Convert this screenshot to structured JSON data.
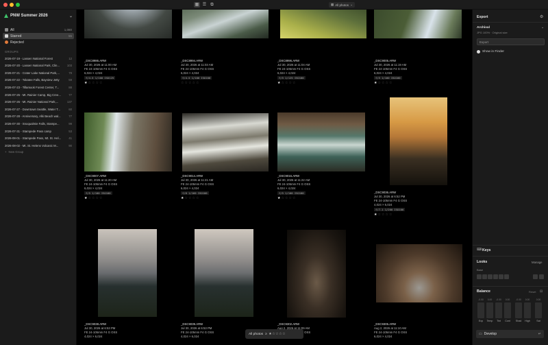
{
  "window": {
    "view_select": "All photos"
  },
  "sidebar": {
    "title": "PNW Summer 2026",
    "library": [
      {
        "label": "All",
        "count": "1,080",
        "color": "#8a8a8a"
      },
      {
        "label": "Starred",
        "count": "55",
        "color": "#d9d9d9"
      },
      {
        "label": "Rejected",
        "count": "",
        "color": "#e07a3a"
      }
    ],
    "groups_label": "GROUPS",
    "groups": [
      {
        "label": "2026-07-19 - Lassen National Forest",
        "count": "12"
      },
      {
        "label": "2026-07-20 - Lassen National Park, Clin...",
        "count": "103"
      },
      {
        "label": "2026-07-21 - Crater Lake National Park,...",
        "count": "79"
      },
      {
        "label": "2026-07-22 - Tokatee Falls, Bayview Jetty",
        "count": "59"
      },
      {
        "label": "2026-07-23 - Tillamook Forest Center, T...",
        "count": "88"
      },
      {
        "label": "2026-07-25 - Mt. Rainier Camp, Big Cree...",
        "count": "77"
      },
      {
        "label": "2026-07-26 - Mt. Rainier National Park,...",
        "count": "137"
      },
      {
        "label": "2026-07-27 - Downtown Seattle, Water T...",
        "count": "60"
      },
      {
        "label": "2026-07-28 - Anniversary, Alki Beach wal...",
        "count": "77"
      },
      {
        "label": "2026-07-30 - Snoqualmie Falls, Stampe...",
        "count": "99"
      },
      {
        "label": "2026-07-31 - Stampede Pass camp",
        "count": "53"
      },
      {
        "label": "2026-08-01 - Stampede Pass, Mt. St. Hel...",
        "count": "41"
      },
      {
        "label": "2026-08-02 - Mt. St. Helens Volcanic M...",
        "count": "90"
      }
    ],
    "new_group": "New Group"
  },
  "photos": [
    {
      "file": "_DSC8986.ARW",
      "date": "Jul 30, 2026 at 11:00 AM",
      "lens": "FE 24-105mm F4 G OSS",
      "dims": "6,024 × 4,024",
      "exif": "f/4.5 1/100 ISO125",
      "rating": 1
    },
    {
      "file": "_DSC8994.ARW",
      "date": "Jul 30, 2026 at 11:03 AM",
      "lens": "FE 24-105mm F4 G OSS",
      "dims": "6,024 × 4,024",
      "exif": "f/4.5 1/100 ISO100",
      "rating": 0
    },
    {
      "file": "_DSC8996.ARW",
      "date": "Jul 30, 2026 at 11:04 AM",
      "lens": "FE 24-105mm F4 G OSS",
      "dims": "6,024 × 4,024",
      "exif": "f/5 1/125 ISO100",
      "rating": 1
    },
    {
      "file": "_DSC9005.ARW",
      "date": "Jul 30, 2026 at 11:19 AM",
      "lens": "FE 24-105mm F4 G OSS",
      "dims": "6,024 × 4,024",
      "exif": "f/5 1/100 ISO100",
      "rating": 1
    },
    {
      "file": "_DSC9007.ARW",
      "date": "Jul 30, 2026 at 11:20 AM",
      "lens": "FE 24-105mm F4 G OSS",
      "dims": "6,024 × 4,024",
      "exif": "f/5 1/100 ISO100",
      "rating": 1
    },
    {
      "file": "_DSC9014.ARW",
      "date": "Jul 30, 2026 at 11:21 AM",
      "lens": "FE 24-105mm F4 G OSS",
      "dims": "6,024 × 4,024",
      "exif": "f/8 1/160 ISO100",
      "rating": 1
    },
    {
      "file": "_DSC9016.ARW",
      "date": "Jul 30, 2026 at 11:22 AM",
      "lens": "FE 24-105mm F4 G OSS",
      "dims": "6,024 × 4,024",
      "exif": "f/5 1/100 ISO100",
      "rating": 1
    },
    {
      "file": "_DSC9036.ARW",
      "date": "Jul 30, 2026 at 6:52 PM",
      "lens": "FE 24-105mm F4 G OSS",
      "dims": "4,024 × 6,024",
      "exif": "f/7.1 1/200 ISO100",
      "rating": 1
    },
    {
      "file": "_DSC9038.ARW",
      "date": "Jul 30, 2026 at 6:53 PM",
      "lens": "FE 24-105mm F4 G OSS",
      "dims": "4,024 × 6,024",
      "exif": "",
      "rating": 0
    },
    {
      "file": "_DSC9039.ARW",
      "date": "Jul 30, 2026 at 6:53 PM",
      "lens": "FE 24-105mm F4 G OSS",
      "dims": "4,024 × 6,024",
      "exif": "",
      "rating": 0
    },
    {
      "file": "_DSC9302.ARW",
      "date": "Aug 2, 2026 at 11:09 AM",
      "lens": "FE 24-105mm F4 G OSS",
      "dims": "4,024 × 6,024",
      "exif": "",
      "rating": 0
    },
    {
      "file": "_DSC9305.ARW",
      "date": "Aug 2, 2026 at 11:10 AM",
      "lens": "FE 24-105mm F4 G OSS",
      "dims": "6,024 × 4,024",
      "exif": "",
      "rating": 0
    }
  ],
  "filterbar": {
    "label": "All photos",
    "stars": "≥ ★☆☆☆☆"
  },
  "panel": {
    "export_title": "Export",
    "preset_name": "Archival",
    "preset_desc": "JPG 100% · Original size",
    "export_button": "Export",
    "show_in_finder": "Show in Finder",
    "keys_title": "Keys",
    "looks_title": "Looks",
    "looks_manage": "Manage",
    "base_label": "Base",
    "balance_title": "Balance",
    "balance_reset": "Reset",
    "balance_values": [
      "-0.00",
      "0.00",
      "-0.00",
      "0.00",
      "-0.00",
      "0.00",
      "0.00"
    ],
    "balance_labels": [
      "Exp",
      "Temp",
      "Tint",
      "Cont",
      "Shad",
      "High",
      "Sat"
    ],
    "develop_button": "Develop"
  },
  "colors": {
    "accent_green": "#3fc46b",
    "rejected_orange": "#e07a3a"
  }
}
